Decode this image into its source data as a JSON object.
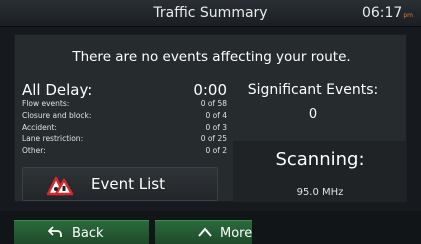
{
  "header": {
    "title": "Traffic Summary",
    "time": "06:17",
    "time_suffix": "pm"
  },
  "message": "There are no events affecting your route.",
  "delay": {
    "label": "All Delay:",
    "value": "0:00",
    "categories": [
      {
        "label": "Flow events:",
        "value": "0 of 58"
      },
      {
        "label": "Closure and block:",
        "value": "0 of 4"
      },
      {
        "label": "Accident:",
        "value": "0 of 3"
      },
      {
        "label": "Lane restriction:",
        "value": "0 of 25"
      },
      {
        "label": "Other:",
        "value": "0 of 2"
      }
    ]
  },
  "significant": {
    "label": "Significant Events:",
    "count": "0"
  },
  "scanning": {
    "label": "Scanning:",
    "frequency": "95.0 MHz"
  },
  "event_list_button": {
    "label": "Event List",
    "icon": "traffic-warning-icon"
  },
  "footer": {
    "back_label": "Back",
    "back_icon": "back-arrow-icon",
    "more_label": "More",
    "more_icon": "chevron-up-icon"
  }
}
